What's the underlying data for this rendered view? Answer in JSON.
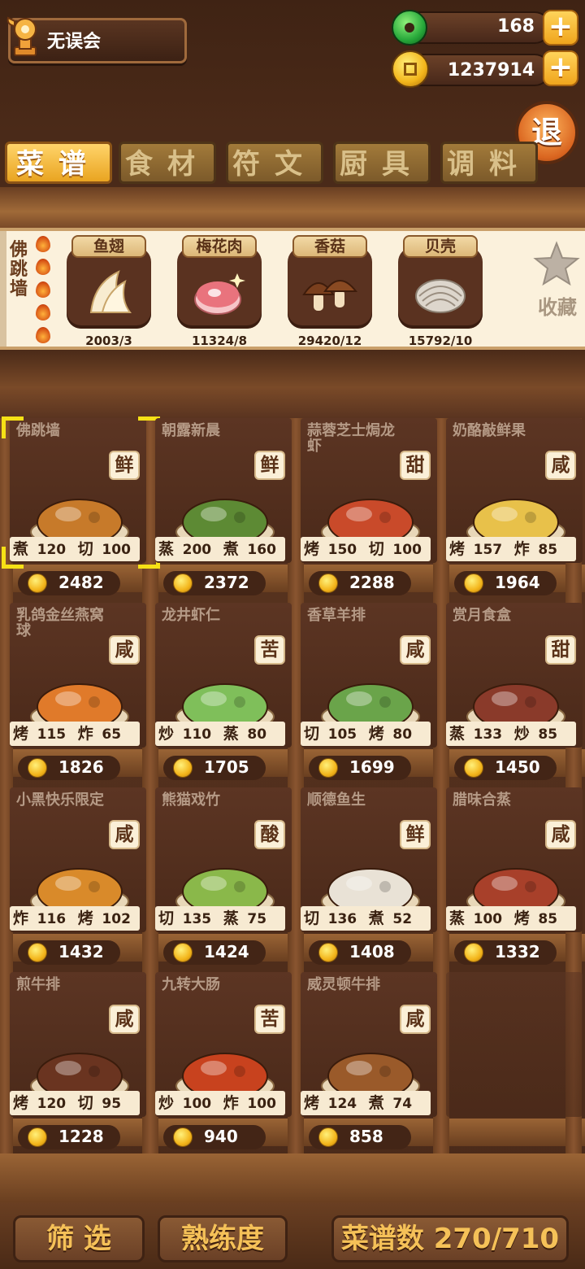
{
  "player": {
    "name": "无误会"
  },
  "currency": {
    "jade": "168",
    "coins": "1237914",
    "plus": "+"
  },
  "back_label": "退",
  "tabs": [
    {
      "label": "菜谱",
      "active": true
    },
    {
      "label": "食材",
      "active": false
    },
    {
      "label": "符文",
      "active": false
    },
    {
      "label": "厨具",
      "active": false
    },
    {
      "label": "调料",
      "active": false
    }
  ],
  "selected_dish": {
    "name": "佛跳墙",
    "level_flames": 5,
    "ingredients": [
      {
        "name": "鱼翅",
        "count": "2003/3",
        "icon": "shark-fin-icon"
      },
      {
        "name": "梅花肉",
        "count": "11324/8",
        "icon": "pork-icon"
      },
      {
        "name": "香菇",
        "count": "29420/12",
        "icon": "mushroom-icon"
      },
      {
        "name": "贝壳",
        "count": "15792/10",
        "icon": "shell-icon"
      }
    ],
    "favorite_label": "收藏"
  },
  "recipes": [
    {
      "name": "佛跳墙",
      "taste": "鲜",
      "s1": "煮",
      "v1": "120",
      "s2": "切",
      "v2": "100",
      "price": "2482",
      "color": "#c77a2a",
      "selected": true
    },
    {
      "name": "朝露新晨",
      "taste": "鲜",
      "s1": "蒸",
      "v1": "200",
      "s2": "煮",
      "v2": "160",
      "price": "2372",
      "color": "#5d8a34"
    },
    {
      "name": "蒜蓉芝士焗龙虾",
      "taste": "甜",
      "s1": "烤",
      "v1": "150",
      "s2": "切",
      "v2": "100",
      "price": "2288",
      "color": "#c94a2a"
    },
    {
      "name": "奶酪敲鲜果",
      "taste": "咸",
      "s1": "烤",
      "v1": "157",
      "s2": "炸",
      "v2": "85",
      "price": "1964",
      "color": "#e8c14a"
    },
    {
      "name": "乳鸽金丝燕窝球",
      "taste": "咸",
      "s1": "烤",
      "v1": "115",
      "s2": "炸",
      "v2": "65",
      "price": "1826",
      "color": "#e07a2a"
    },
    {
      "name": "龙井虾仁",
      "taste": "苦",
      "s1": "炒",
      "v1": "110",
      "s2": "蒸",
      "v2": "80",
      "price": "1705",
      "color": "#7fbf5a"
    },
    {
      "name": "香草羊排",
      "taste": "咸",
      "s1": "切",
      "v1": "105",
      "s2": "烤",
      "v2": "80",
      "price": "1699",
      "color": "#6aa44a"
    },
    {
      "name": "赏月食盒",
      "taste": "甜",
      "s1": "蒸",
      "v1": "133",
      "s2": "炒",
      "v2": "85",
      "price": "1450",
      "color": "#8a3a2a"
    },
    {
      "name": "小黑快乐限定",
      "taste": "咸",
      "s1": "炸",
      "v1": "116",
      "s2": "烤",
      "v2": "102",
      "price": "1432",
      "color": "#d98a2a"
    },
    {
      "name": "熊猫戏竹",
      "taste": "酸",
      "s1": "切",
      "v1": "135",
      "s2": "蒸",
      "v2": "75",
      "price": "1424",
      "color": "#8ab84a"
    },
    {
      "name": "顺德鱼生",
      "taste": "鲜",
      "s1": "切",
      "v1": "136",
      "s2": "煮",
      "v2": "52",
      "price": "1408",
      "color": "#e9e2d6"
    },
    {
      "name": "腊味合蒸",
      "taste": "咸",
      "s1": "蒸",
      "v1": "100",
      "s2": "烤",
      "v2": "85",
      "price": "1332",
      "color": "#a8402a"
    },
    {
      "name": "煎牛排",
      "taste": "咸",
      "s1": "烤",
      "v1": "120",
      "s2": "切",
      "v2": "95",
      "price": "1228",
      "color": "#6a3420"
    },
    {
      "name": "九转大肠",
      "taste": "苦",
      "s1": "炒",
      "v1": "100",
      "s2": "炸",
      "v2": "100",
      "price": "940",
      "color": "#c8421e"
    },
    {
      "name": "威灵顿牛排",
      "taste": "咸",
      "s1": "烤",
      "v1": "124",
      "s2": "煮",
      "v2": "74",
      "price": "858",
      "color": "#9a5a2a"
    }
  ],
  "bottom": {
    "filter": "筛 选",
    "proficiency": "熟练度",
    "recipe_count": "菜谱数 270/710"
  }
}
